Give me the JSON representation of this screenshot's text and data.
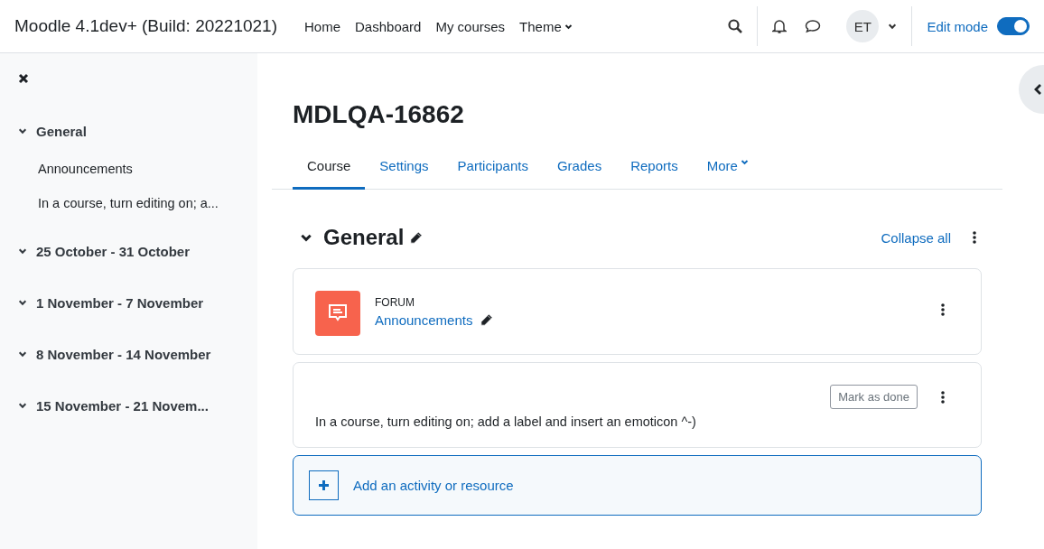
{
  "navbar": {
    "brand": "Moodle 4.1dev+ (Build: 20221021)",
    "links": [
      {
        "label": "Home",
        "dropdown": false
      },
      {
        "label": "Dashboard",
        "dropdown": false
      },
      {
        "label": "My courses",
        "dropdown": false
      },
      {
        "label": "Theme",
        "dropdown": true
      }
    ],
    "avatar": "ET",
    "edit_mode": {
      "label": "Edit mode",
      "on": true
    }
  },
  "course_index": [
    {
      "title": "General",
      "expanded": true,
      "children": [
        {
          "label": "Announcements"
        },
        {
          "label": "In a course, turn editing on; a..."
        }
      ]
    },
    {
      "title": "25 October - 31 October",
      "expanded": true
    },
    {
      "title": "1 November - 7 November",
      "expanded": true
    },
    {
      "title": "8 November - 14 November",
      "expanded": true
    },
    {
      "title": "15 November - 21 Novem...",
      "expanded": true
    }
  ],
  "course": {
    "title": "MDLQA-16862",
    "tabs": [
      {
        "label": "Course",
        "selected": true,
        "dropdown": false
      },
      {
        "label": "Settings",
        "selected": false,
        "dropdown": false
      },
      {
        "label": "Participants",
        "selected": false,
        "dropdown": false
      },
      {
        "label": "Grades",
        "selected": false,
        "dropdown": false
      },
      {
        "label": "Reports",
        "selected": false,
        "dropdown": false
      },
      {
        "label": "More",
        "selected": false,
        "dropdown": true
      }
    ],
    "section": {
      "title": "General",
      "expanded": true,
      "collapse_all": "Collapse all",
      "activities": [
        {
          "kind": "forum",
          "type_label": "FORUM",
          "name": "Announcements"
        },
        {
          "kind": "label",
          "text": "In a course, turn editing on; add a label and insert an emoticon ^-)",
          "completion": "Mark as done"
        }
      ],
      "add_activity": "Add an activity or resource"
    }
  }
}
